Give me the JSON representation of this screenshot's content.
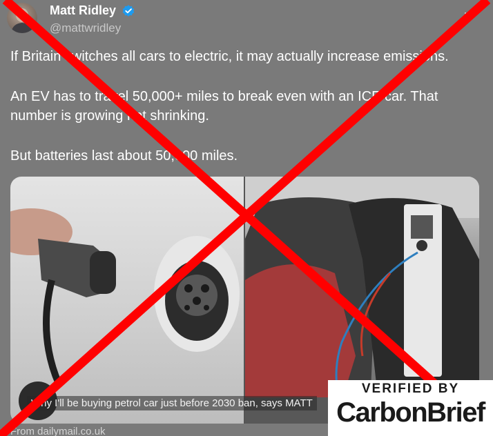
{
  "author": {
    "name": "Matt Ridley",
    "handle": "@mattwridley",
    "verified": true
  },
  "tweet": {
    "paragraphs": [
      "If Britain switches all cars to electric, it may actually increase emissions.",
      "An EV has to travel 50,000+ miles to break even with an ICE car. That number is growing not shrinking.",
      "But batteries last about 50,000 miles."
    ]
  },
  "media": {
    "caption": "Why I'll be buying petrol car just before 2030 ban, says MATT",
    "source": "From dailymail.co.uk"
  },
  "stamp": {
    "line1": "VERIFIED BY",
    "line2": "CarbonBrief"
  },
  "colors": {
    "overlay_gray": "#7a7a7a",
    "cross_red": "#ff0000",
    "verified_blue": "#1d9bf0"
  },
  "icons": [
    "verified-badge-icon",
    "more-options-icon"
  ]
}
